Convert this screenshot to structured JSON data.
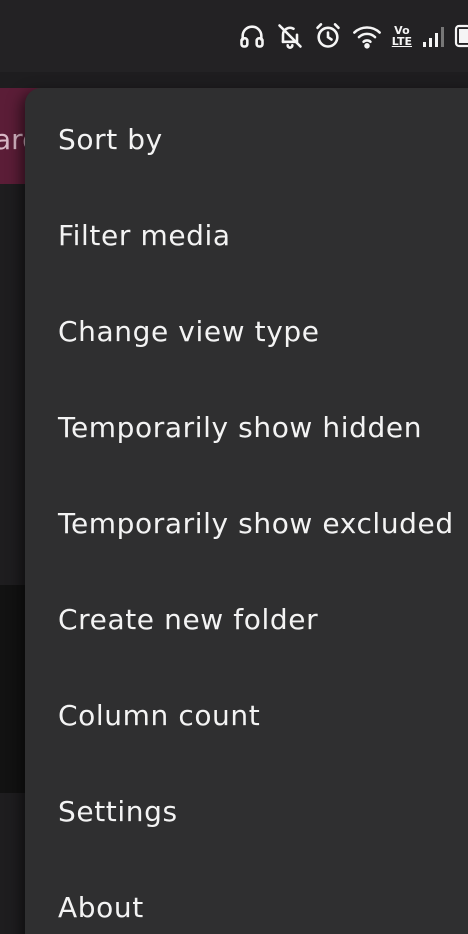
{
  "status_bar": {
    "icons": [
      "headphones-icon",
      "bell-off-icon",
      "alarm-icon",
      "wifi-icon",
      "volte-icon",
      "signal-icon",
      "battery-icon"
    ],
    "volte_top": "Vo",
    "volte_bottom": "LTE"
  },
  "background": {
    "toolbar_color": "#5b1d37",
    "toolbar_text_fragment": "ard"
  },
  "menu": {
    "items": [
      {
        "label": "Sort by"
      },
      {
        "label": "Filter media"
      },
      {
        "label": "Change view type"
      },
      {
        "label": "Temporarily show hidden"
      },
      {
        "label": "Temporarily show excluded"
      },
      {
        "label": "Create new folder"
      },
      {
        "label": "Column count"
      },
      {
        "label": "Settings"
      },
      {
        "label": "About"
      }
    ]
  },
  "colors": {
    "menu_background": "#2f2f30",
    "screen_background": "#1e1d1f",
    "text": "#f3f3f3"
  }
}
